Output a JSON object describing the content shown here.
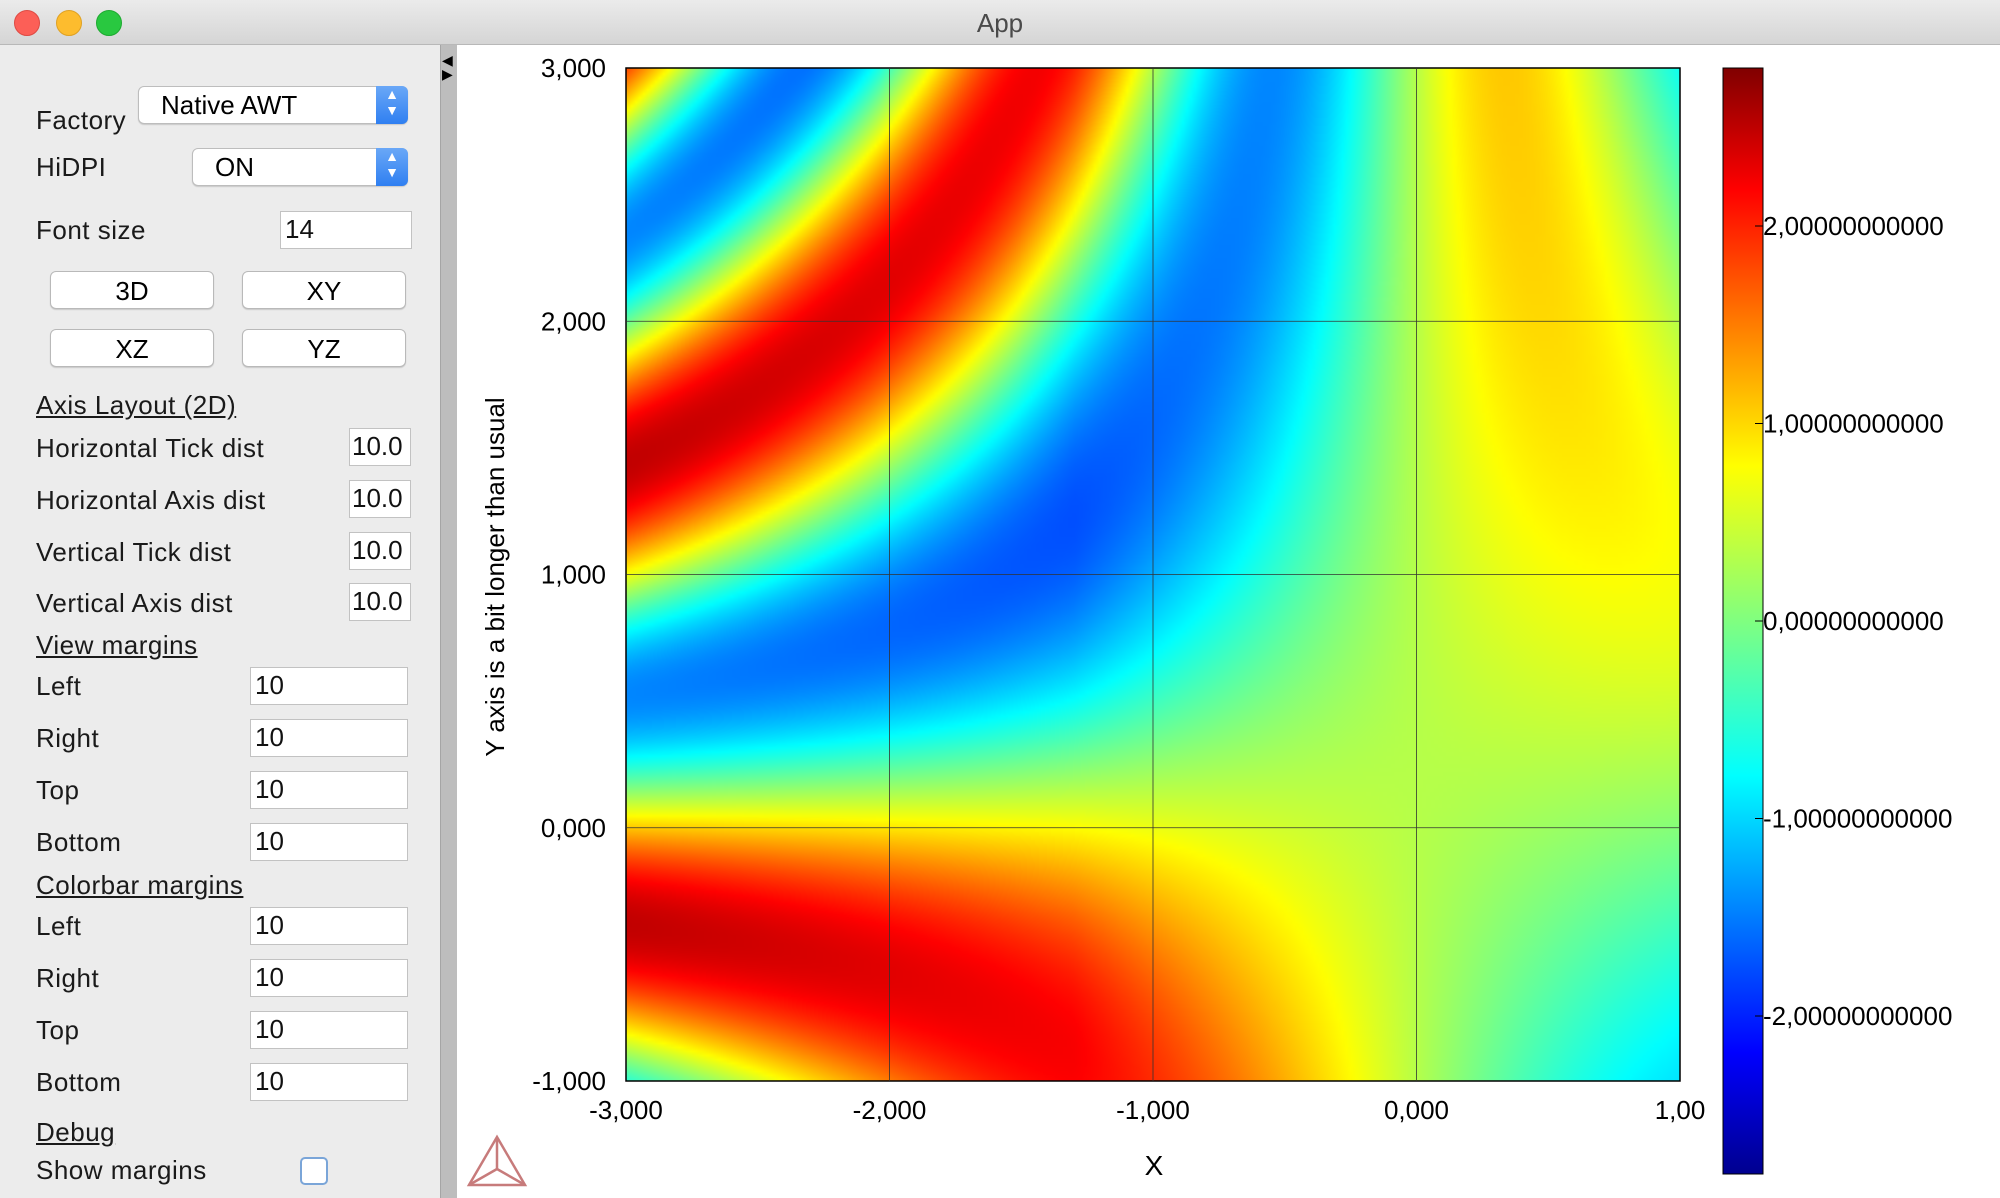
{
  "window": {
    "title": "App"
  },
  "panel": {
    "factory": {
      "label": "Factory",
      "value": "Native AWT"
    },
    "hidpi": {
      "label": "HiDPI",
      "value": "ON"
    },
    "font_size": {
      "label": "Font size",
      "value": "14"
    },
    "view_buttons": [
      "3D",
      "XY",
      "XZ",
      "YZ"
    ],
    "axis_layout": {
      "title": "Axis Layout (2D)",
      "horizontal_tick_dist": {
        "label": "Horizontal Tick dist",
        "value": "10.0"
      },
      "horizontal_axis_dist": {
        "label": "Horizontal Axis dist",
        "value": "10.0"
      },
      "vertical_tick_dist": {
        "label": "Vertical Tick dist",
        "value": "10.0"
      },
      "vertical_axis_dist": {
        "label": "Vertical Axis dist",
        "value": "10.0"
      }
    },
    "view_margins": {
      "title": "View margins",
      "left": {
        "label": "Left",
        "value": "10"
      },
      "right": {
        "label": "Right",
        "value": "10"
      },
      "top": {
        "label": "Top",
        "value": "10"
      },
      "bottom": {
        "label": "Bottom",
        "value": "10"
      }
    },
    "colorbar_margins": {
      "title": "Colorbar margins",
      "left": {
        "label": "Left",
        "value": "10"
      },
      "right": {
        "label": "Right",
        "value": "10"
      },
      "top": {
        "label": "Top",
        "value": "10"
      },
      "bottom": {
        "label": "Bottom",
        "value": "10"
      }
    },
    "debug": {
      "title": "Debug",
      "show_margins": {
        "label": "Show margins",
        "checked": false
      }
    }
  },
  "icons": {
    "collapse": "collapse-arrow-icon",
    "logo": "triangle-logo-icon"
  },
  "chart_data": {
    "type": "heatmap",
    "title": "",
    "xlabel": "X",
    "ylabel": "Y axis is a bit longer than usual",
    "xlim": [
      -3,
      1
    ],
    "ylim": [
      -1,
      3
    ],
    "x_ticks": [
      "-3,000",
      "-2,000",
      "-1,000",
      "0,000",
      "1,00"
    ],
    "y_ticks": [
      "3,000",
      "2,000",
      "1,000",
      "0,000",
      "-1,000"
    ],
    "colorbar": {
      "colormap": "jet",
      "range": [
        -2.8,
        2.8
      ],
      "tick_labels": [
        "2,00000000000",
        "1,00000000000",
        "0,00000000000",
        "-1,00000000000",
        "-2,00000000000"
      ],
      "tick_values": [
        2,
        1,
        0,
        -1,
        -2
      ]
    },
    "grid": true
  }
}
